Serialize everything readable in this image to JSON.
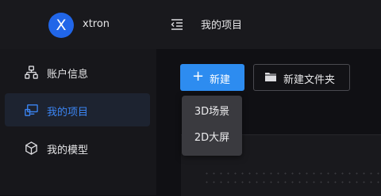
{
  "brand": {
    "avatar_letter": "X",
    "name": "xtron"
  },
  "header": {
    "title": "我的项目",
    "fold_icon": "menu-fold-icon"
  },
  "sidebar": {
    "items": [
      {
        "label": "账户信息",
        "icon": "account-icon",
        "active": false
      },
      {
        "label": "我的项目",
        "icon": "project-icon",
        "active": true
      },
      {
        "label": "我的模型",
        "icon": "model-cube-icon",
        "active": false
      }
    ]
  },
  "toolbar": {
    "new_label": "新建",
    "new_folder_label": "新建文件夹"
  },
  "new_menu": {
    "items": [
      "3D场景",
      "2D大屏"
    ]
  },
  "colors": {
    "accent": "#2d8cf0",
    "active_text": "#3c86f5",
    "avatar_bg": "#2166e8"
  }
}
